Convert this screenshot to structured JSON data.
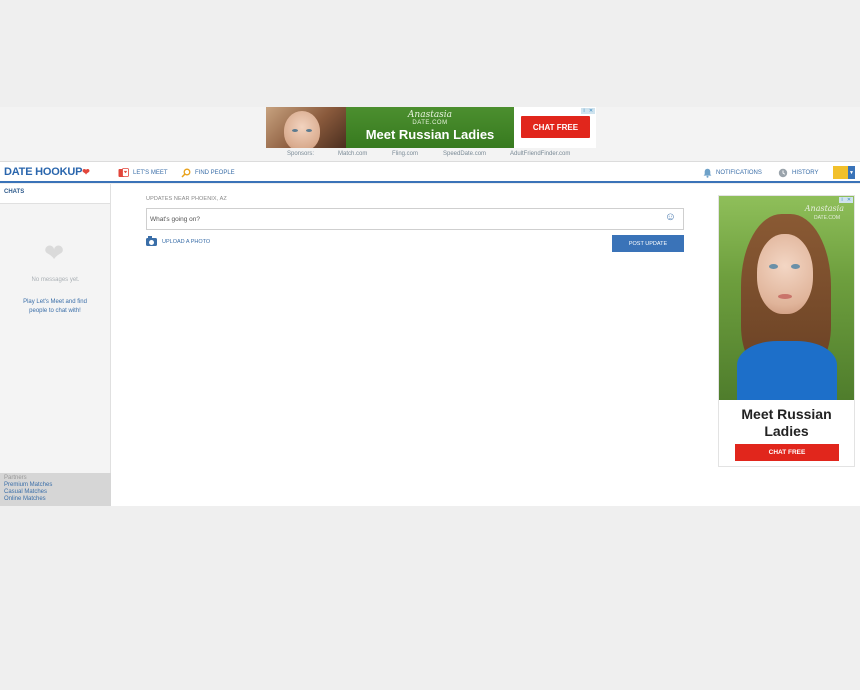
{
  "top_ad": {
    "brand": "Anastasia",
    "brand_sub": "DATE.COM",
    "headline": "Meet Russian Ladies",
    "cta": "CHAT FREE",
    "info_glyph": "i",
    "close_glyph": "✕"
  },
  "sponsors": {
    "label": "Sponsors:",
    "links": [
      "Match.com",
      "Fling.com",
      "SpeedDate.com",
      "AdultFriendFinder.com"
    ]
  },
  "nav": {
    "logo": "DATE HOOKUP",
    "lets_meet": "LET'S MEET",
    "find_people": "FIND PEOPLE",
    "notifications": "NOTIFICATIONS",
    "history": "HISTORY",
    "icons": {
      "logo_heart": "heart-icon",
      "lets_meet": "cards-icon",
      "find_people": "magnifier-icon",
      "notifications": "bell-icon",
      "history": "clock-icon",
      "menu": "caret-down-icon"
    }
  },
  "sidebar": {
    "header": "CHATS",
    "empty_text": "No messages yet.",
    "hint": "Play Let's Meet and find people to chat with!",
    "partners": {
      "title": "Partners",
      "links": [
        "Premium Matches",
        "Casual Matches",
        "Online Matches"
      ]
    }
  },
  "updates": {
    "label": "UPDATES NEAR PHOENIX, AZ",
    "placeholder": "What's going on?",
    "upload_label": "UPLOAD A PHOTO",
    "post_label": "POST UPDATE"
  },
  "side_ad": {
    "brand": "Anastasia",
    "brand_sub": "DATE.COM",
    "headline": "Meet Russian Ladies",
    "cta": "CHAT FREE"
  },
  "colors": {
    "brand_blue": "#3a73b8",
    "link_blue": "#3a6ea8",
    "cta_red": "#e1261c",
    "ad_green": "#377a1f",
    "avatar_yellow": "#f2c02b"
  }
}
